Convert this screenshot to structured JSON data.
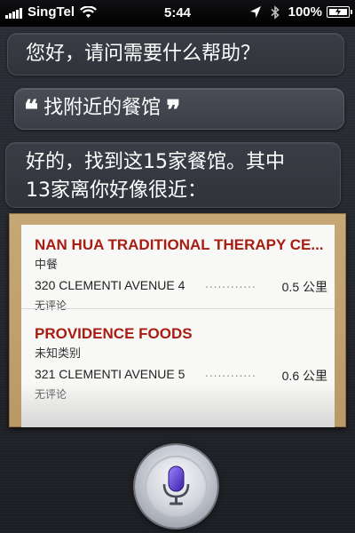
{
  "status_bar": {
    "carrier": "SingTel",
    "time": "5:44",
    "battery_percent": "100%",
    "icons": [
      "signal-icon",
      "wifi-icon",
      "location-icon",
      "bluetooth-icon",
      "battery-charging-icon"
    ]
  },
  "conversation": {
    "assistant_greeting": "您好，请问需要什么帮助？",
    "user_query": {
      "open_quote": "❝",
      "prefix": "找",
      "rest": "附近的餐馆",
      "close_quote": "❞"
    },
    "assistant_reply_line1": "好的，找到这15家餐馆。其中",
    "assistant_reply_line2": "13家离你好像很近："
  },
  "results": [
    {
      "name": "NAN HUA TRADITIONAL THERAPY CE...",
      "category": "中餐",
      "address": "320 CLEMENTI AVENUE 4",
      "leader": "............",
      "distance": "0.5 公里",
      "reviews": "无评论"
    },
    {
      "name": "PROVIDENCE FOODS",
      "category": "未知类别",
      "address": "321 CLEMENTI AVENUE 5",
      "leader": "............",
      "distance": "0.6 公里",
      "reviews": "无评论"
    }
  ],
  "colors": {
    "result_name": "#a81c12",
    "card_frame": "#c6a877",
    "background": "#25272e"
  },
  "mic": {
    "icon": "microphone-icon"
  }
}
